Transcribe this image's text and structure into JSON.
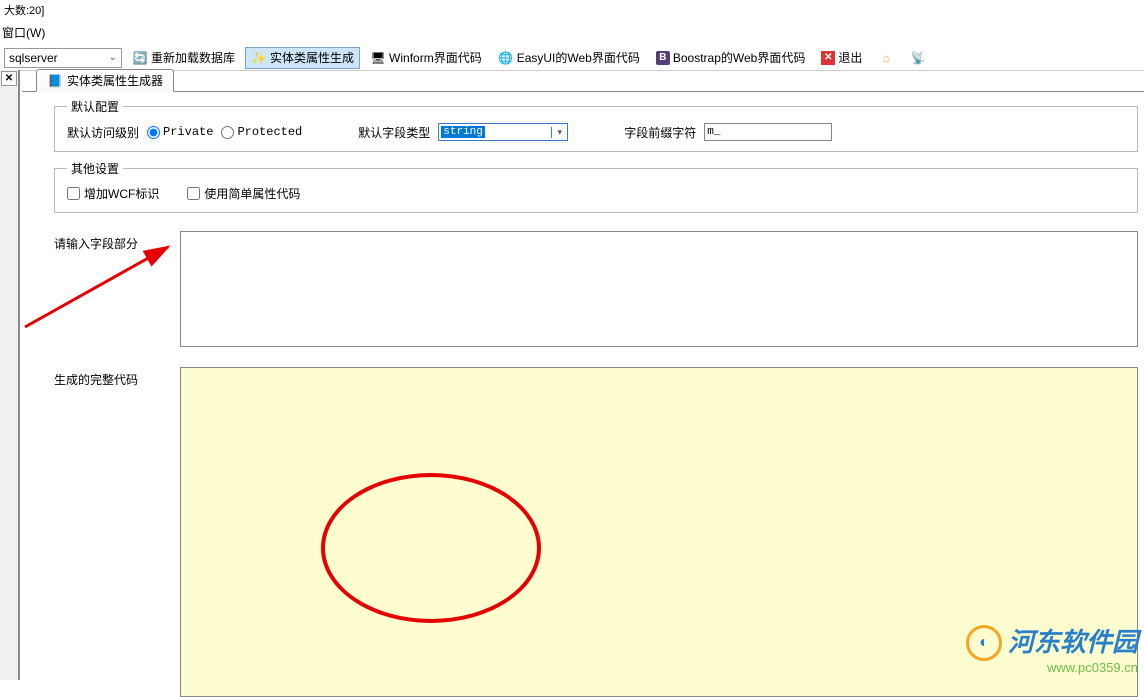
{
  "topLine": "大数:20]",
  "menu": {
    "window": "窗口(W)"
  },
  "toolbar": {
    "dbSelected": "sqlserver",
    "reload": "重新加载数据库",
    "entityGen": "实体类属性生成",
    "winform": "Winform界面代码",
    "easyui": "EasyUI的Web界面代码",
    "bootstrap": "Boostrap的Web界面代码",
    "exit": "退出"
  },
  "tab": {
    "title": "实体类属性生成器"
  },
  "defaults": {
    "legend": "默认配置",
    "accessLabel": "默认访问级别",
    "radioPrivate": "Private",
    "radioProtected": "Protected",
    "fieldTypeLabel": "默认字段类型",
    "fieldTypeValue": "string",
    "prefixLabel": "字段前缀字符",
    "prefixValue": "m_"
  },
  "other": {
    "legend": "其他设置",
    "wcf": "增加WCF标识",
    "simple": "使用简单属性代码"
  },
  "inputSection": {
    "label": "请输入字段部分"
  },
  "outputSection": {
    "label": "生成的完整代码"
  },
  "watermark": {
    "title": "河东软件园",
    "url": "www.pc0359.cn"
  }
}
